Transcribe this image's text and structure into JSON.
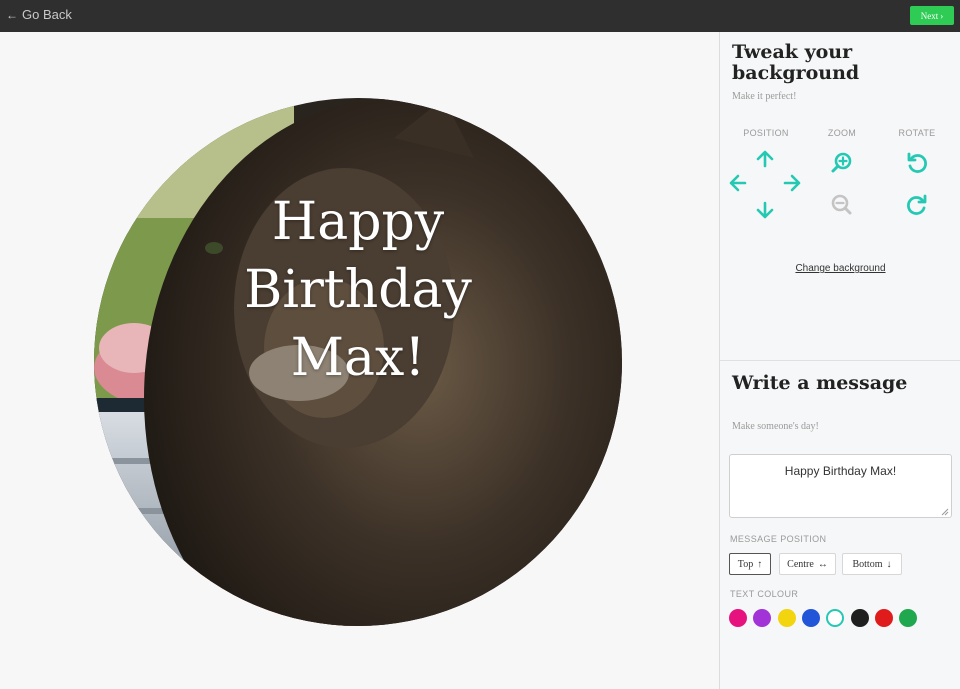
{
  "header": {
    "back_label": "Go Back",
    "next_label": "Next"
  },
  "canvas": {
    "message_text": "Happy\nBirthday\nMax!"
  },
  "background_section": {
    "title": "Tweak your background",
    "subtitle": "Make it perfect!",
    "controls": {
      "position_label": "POSITION",
      "zoom_label": "ZOOM",
      "rotate_label": "ROTATE"
    },
    "change_background_label": "Change background"
  },
  "message_section": {
    "title": "Write a message",
    "subtitle": "Make someone's day!",
    "message_value": "Happy Birthday Max!",
    "message_position_label": "MESSAGE POSITION",
    "positions": [
      {
        "label": "Top",
        "arrow": "↑",
        "selected": true
      },
      {
        "label": "Centre",
        "arrow": "↔",
        "selected": false
      },
      {
        "label": "Bottom",
        "arrow": "↓",
        "selected": false
      }
    ],
    "text_colour_label": "TEXT COLOUR",
    "colours": [
      "#e6127e",
      "#a233d6",
      "#f2d40f",
      "#2355d8",
      "#ffffff",
      "#1f1f1f",
      "#e01b1b",
      "#1fa84e"
    ],
    "selected_colour": "#ffffff"
  },
  "theme": {
    "accent": "#25c9b3",
    "next_green": "#2ecc55",
    "topbar": "#2f2f2f"
  }
}
